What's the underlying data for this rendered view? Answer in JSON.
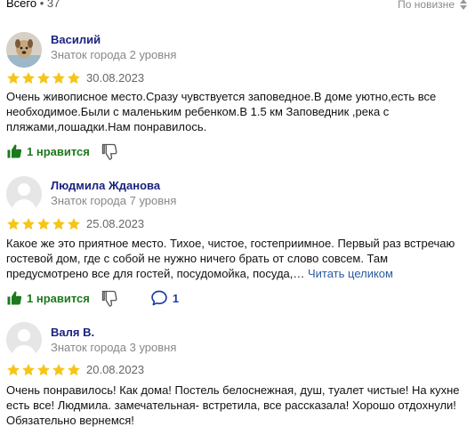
{
  "header": {
    "total_label": "Всего",
    "total_sep": " • ",
    "total_count": "37",
    "sort_label": "По новизне"
  },
  "reviews": [
    {
      "author": "Василий",
      "level": "Знаток города 2 уровня",
      "rating": 5,
      "date": "30.08.2023",
      "text": "Очень живописное место.Сразу чувствуется заповедное.В доме уютно,есть все необходимое.Были с маленьким ребенком.В 1.5 км Заповедник ,река с пляжами,лошадки.Нам понравилось.",
      "likes_label": "1 нравится"
    },
    {
      "author": "Людмила Жданова",
      "level": "Знаток города 7 уровня",
      "rating": 5,
      "date": "25.08.2023",
      "text": "Какое же это приятное место. Тихое, чистое, гостеприимное. Первый раз встречаю гостевой дом, где с собой не нужно ничего брать от слово совсем. Там предусмотрено все для гостей, посудомойка, посуда,… ",
      "read_more": "Читать целиком",
      "likes_label": "1 нравится",
      "comments_count": "1"
    },
    {
      "author": "Валя В.",
      "level": "Знаток города 3 уровня",
      "rating": 5,
      "date": "20.08.2023",
      "text": "Очень понравилось! Как дома! Постель белоснежная, душ, туалет чистые! На кухне есть все! Людмила. замечательная- встретила, все рассказала! Хорошо отдохнули! Обязательно вернемся!"
    }
  ],
  "colors": {
    "star": "#f5c518",
    "like_green": "#1c7a1c",
    "author_blue": "#1a237e",
    "link_blue": "#2c5aa0"
  },
  "icons": [
    "sort-arrows-icon",
    "star-icon",
    "thumbs-up-icon",
    "thumbs-down-icon",
    "comment-icon",
    "user-avatar-icon"
  ]
}
